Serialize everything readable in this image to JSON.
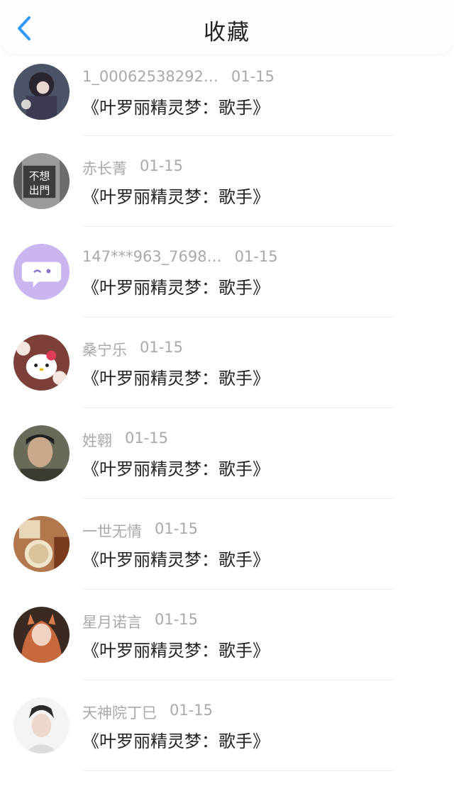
{
  "header": {
    "title": "收藏",
    "back_icon": "chevron-left-icon",
    "accent_color": "#2f9bff"
  },
  "items": [
    {
      "name": "1_00062538292…",
      "time": "01-15",
      "text": "《叶罗丽精灵梦：歌手》"
    },
    {
      "name": "赤长菁",
      "time": "01-15",
      "text": "《叶罗丽精灵梦：歌手》",
      "avatar_text": "不想 出門"
    },
    {
      "name": "147***963_7698…",
      "time": "01-15",
      "text": "《叶罗丽精灵梦：歌手》"
    },
    {
      "name": "桑宁乐",
      "time": "01-15",
      "text": "《叶罗丽精灵梦：歌手》"
    },
    {
      "name": "姓翱",
      "time": "01-15",
      "text": "《叶罗丽精灵梦：歌手》"
    },
    {
      "name": "一世无情",
      "time": "01-15",
      "text": "《叶罗丽精灵梦：歌手》"
    },
    {
      "name": "星月诺言",
      "time": "01-15",
      "text": "《叶罗丽精灵梦：歌手》"
    },
    {
      "name": "天神院丁巳",
      "time": "01-15",
      "text": "《叶罗丽精灵梦：歌手》"
    }
  ]
}
